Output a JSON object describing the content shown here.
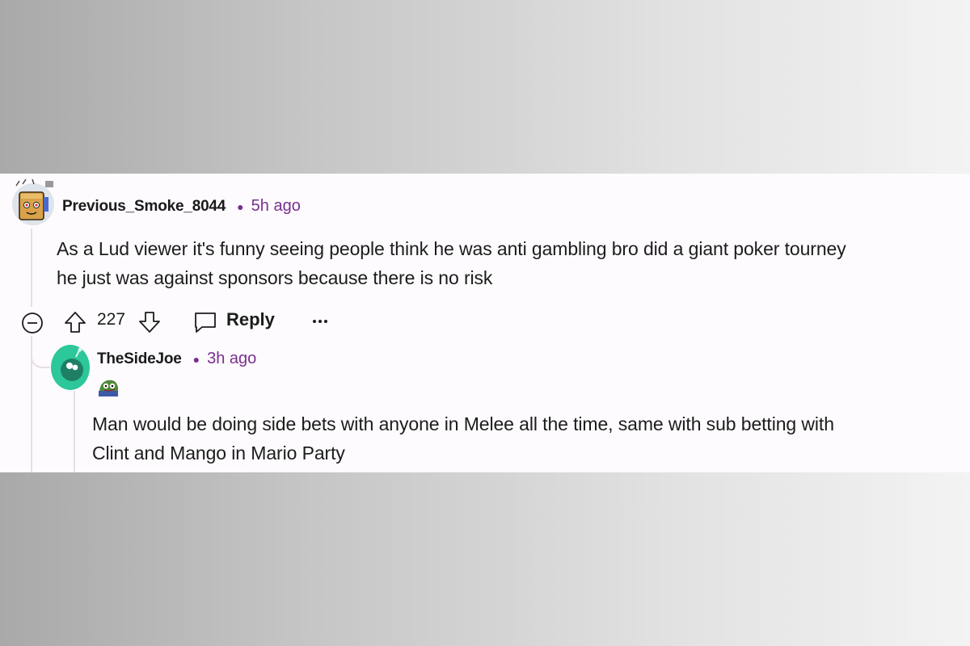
{
  "comments": [
    {
      "username": "Previous_Smoke_8044",
      "time": "5h ago",
      "body_line1": "As a Lud viewer it's funny seeing people think he was anti gambling bro did a giant poker tourney",
      "body_line2": "he just was against sponsors because there is no risk",
      "avatar_icon": "robot-box-avatar",
      "votes": "227",
      "reply_label": "Reply"
    },
    {
      "username": "TheSideJoe",
      "time": "3h ago",
      "flair_icon": "pepe-frog-flair",
      "body_line1": "Man would be doing side bets with anyone in Melee all the time, same with sub betting with",
      "body_line2": "Clint and Mango in Mario Party",
      "avatar_icon": "green-snoo-avatar"
    }
  ],
  "colors": {
    "time_accent": "#7a2f8f",
    "thread_line": "#e7dde7",
    "panel_bg": "#fdfbfd",
    "avatar_green": "#2cc79a"
  }
}
